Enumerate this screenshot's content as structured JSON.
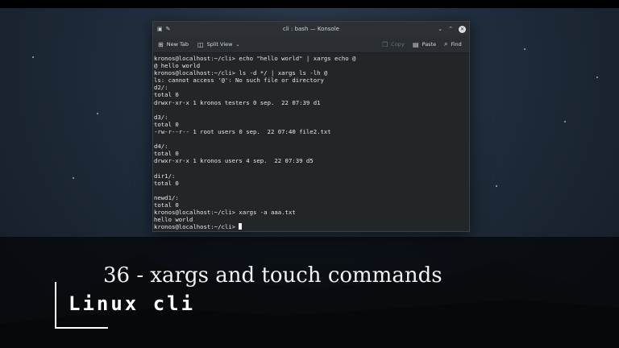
{
  "window": {
    "title": "cli : bash — Konsole"
  },
  "toolbar": {
    "new_tab": "New Tab",
    "split_view": "Split View",
    "copy": "Copy",
    "paste": "Paste",
    "find": "Find"
  },
  "terminal": {
    "lines": [
      "kronos@localhost:~/cli> echo \"hello world\" | xargs echo @",
      "@ hello world",
      "kronos@localhost:~/cli> ls -d */ | xargs ls -lh @",
      "ls: cannot access '@': No such file or directory",
      "d2/:",
      "total 0",
      "drwxr-xr-x 1 kronos testers 0 sep.  22 07:39 d1",
      "",
      "d3/:",
      "total 0",
      "-rw-r--r-- 1 root users 0 sep.  22 07:40 file2.txt",
      "",
      "d4/:",
      "total 0",
      "drwxr-xr-x 1 kronos users 4 sep.  22 07:39 d5",
      "",
      "dir1/:",
      "total 0",
      "",
      "newd1/:",
      "total 0",
      "kronos@localhost:~/cli> xargs -a aaa.txt",
      "hello world"
    ],
    "prompt": "kronos@localhost:~/cli> "
  },
  "banner": {
    "episode": "36 - xargs and touch commands",
    "brand": "Linux cli"
  },
  "colors": {
    "terminal_bg": "#232627",
    "terminal_fg": "#e6e8ea",
    "overlay": "#000000"
  },
  "icons": {
    "new_tab": "new-tab-icon",
    "split_view": "split-view-icon",
    "copy": "copy-icon",
    "paste": "paste-icon",
    "find": "search-icon"
  }
}
